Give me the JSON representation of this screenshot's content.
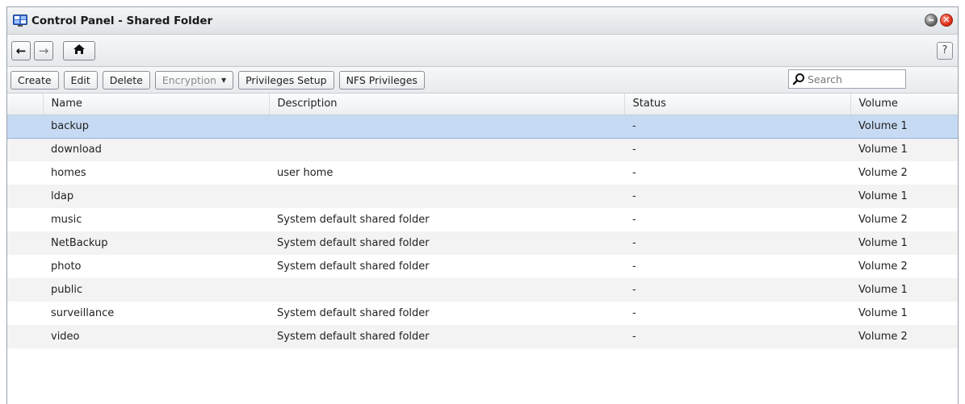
{
  "window": {
    "title": "Control Panel - Shared Folder"
  },
  "nav": {
    "back_icon": "←",
    "forward_icon": "→",
    "home_icon": "⌂",
    "help_label": "?"
  },
  "toolbar": {
    "create": "Create",
    "edit": "Edit",
    "delete": "Delete",
    "encryption": "Encryption",
    "privileges_setup": "Privileges Setup",
    "nfs_privileges": "NFS Privileges"
  },
  "search": {
    "placeholder": "Search",
    "value": ""
  },
  "table": {
    "columns": [
      "Name",
      "Description",
      "Status",
      "Volume"
    ],
    "rows": [
      {
        "name": "backup",
        "description": "",
        "status": "-",
        "volume": "Volume 1",
        "selected": true
      },
      {
        "name": "download",
        "description": "",
        "status": "-",
        "volume": "Volume 1"
      },
      {
        "name": "homes",
        "description": "user home",
        "status": "-",
        "volume": "Volume 2"
      },
      {
        "name": "ldap",
        "description": "",
        "status": "-",
        "volume": "Volume 1"
      },
      {
        "name": "music",
        "description": "System default shared folder",
        "status": "-",
        "volume": "Volume 2"
      },
      {
        "name": "NetBackup",
        "description": "System default shared folder",
        "status": "-",
        "volume": "Volume 1"
      },
      {
        "name": "photo",
        "description": "System default shared folder",
        "status": "-",
        "volume": "Volume 2"
      },
      {
        "name": "public",
        "description": "",
        "status": "-",
        "volume": "Volume 1"
      },
      {
        "name": "surveillance",
        "description": "System default shared folder",
        "status": "-",
        "volume": "Volume 1"
      },
      {
        "name": "video",
        "description": "System default shared folder",
        "status": "-",
        "volume": "Volume 2"
      }
    ]
  },
  "colors": {
    "selection": "#c7daf3",
    "row_alt": "#f3f3f3",
    "close_button": "#e0321c"
  }
}
